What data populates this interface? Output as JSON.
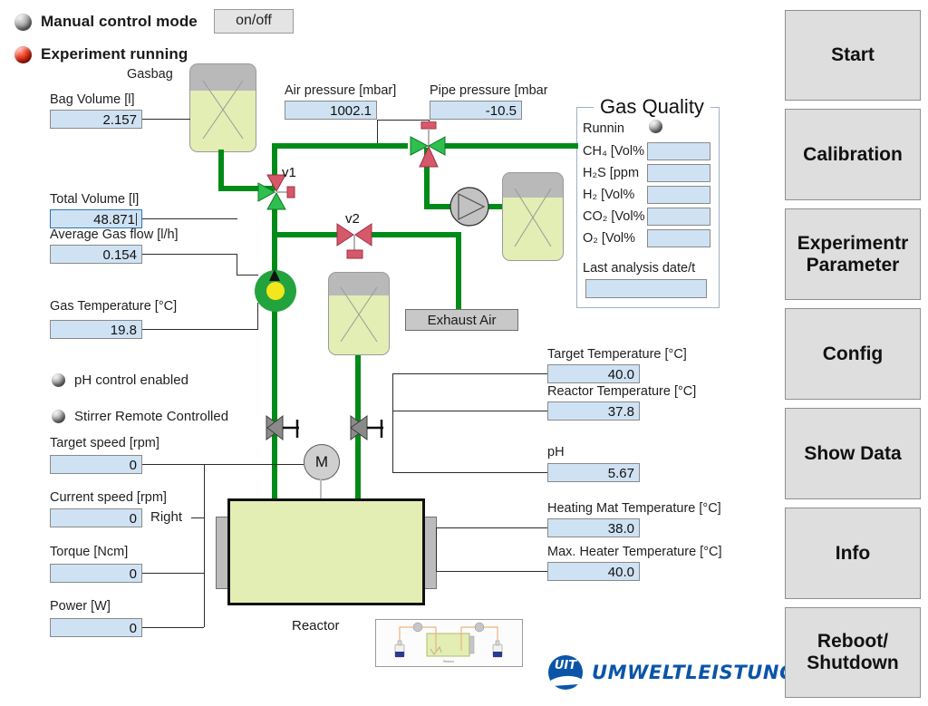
{
  "status": {
    "manual_mode": {
      "label": "Manual control mode",
      "led": "gray-led",
      "button": "on/off"
    },
    "experiment": {
      "label": "Experiment running",
      "led": "red-led"
    }
  },
  "gasbag": {
    "caption": "Gasbag",
    "bag_volume": {
      "label": "Bag Volume [l]",
      "value": "2.157"
    }
  },
  "pressures": {
    "air": {
      "label": "Air pressure [mbar]",
      "value": "1002.1"
    },
    "pipe": {
      "label": "Pipe pressure [mbar]",
      "value": "-10.5"
    }
  },
  "gas_measures": {
    "total_volume": {
      "label": "Total Volume [l]",
      "value": "48.871"
    },
    "avg_gas_flow": {
      "label": "Average Gas flow [l/h]",
      "value": "0.154"
    },
    "gas_temperature": {
      "label": "Gas Temperature [°C]",
      "value": "19.8"
    }
  },
  "gas_quality": {
    "title": "Gas Quality",
    "running": {
      "label": "Runnin",
      "led": "gray-led"
    },
    "rows": [
      {
        "label": "CH₄ [Vol%",
        "value": ""
      },
      {
        "label": "H₂S [ppm",
        "value": ""
      },
      {
        "label": "H₂ [Vol%",
        "value": ""
      },
      {
        "label": "CO₂ [Vol%",
        "value": ""
      },
      {
        "label": "O₂ [Vol%",
        "value": ""
      }
    ],
    "last_analysis": {
      "label": "Last analysis date/t",
      "value": ""
    }
  },
  "valves": {
    "v1": "v1",
    "v2": "v2"
  },
  "exhaust": {
    "label": "Exhaust Air"
  },
  "controls": {
    "ph_control": {
      "label": "pH control enabled",
      "led": "gray-led"
    },
    "stirrer_remote": {
      "label": "Stirrer Remote Controlled",
      "led": "gray-led"
    },
    "target_speed": {
      "label": "Target speed [rpm]",
      "value": "0"
    },
    "current_speed": {
      "label": "Current speed [rpm]",
      "value": "0"
    },
    "direction": "Right",
    "torque": {
      "label": "Torque [Ncm]",
      "value": "0"
    },
    "power": {
      "label": "Power [W]",
      "value": "0"
    }
  },
  "reactor": {
    "caption": "Reactor",
    "motor": "M",
    "target_temperature": {
      "label": "Target Temperature [°C]",
      "value": "40.0"
    },
    "reactor_temperature": {
      "label": "Reactor Temperature [°C]",
      "value": "37.8"
    },
    "ph": {
      "label": "pH",
      "value": "5.67"
    },
    "heating_mat_temperature": {
      "label": "Heating Mat Temperature [°C]",
      "value": "38.0"
    },
    "max_heater_temperature": {
      "label": "Max. Heater Temperature [°C]",
      "value": "40.0"
    }
  },
  "nav_buttons": [
    {
      "label": "Start",
      "name": "start"
    },
    {
      "label": "Calibration",
      "name": "calibration"
    },
    {
      "label": "Experimentr Parameter",
      "name": "experiment-parameter"
    },
    {
      "label": "Config",
      "name": "config"
    },
    {
      "label": "Show Data",
      "name": "show-data"
    },
    {
      "label": "Info",
      "name": "info"
    },
    {
      "label": "Reboot/ Shutdown",
      "name": "reboot-shutdown"
    }
  ],
  "logo": {
    "mark": "UIT",
    "word": "UMWELTLEISTUNGEN"
  },
  "colors": {
    "pipe_green": "#008a18",
    "valve_open": "#2fbf4f",
    "valve_closed": "#d6586a",
    "field_blue": "#cfe2f3",
    "liquid_green": "#e2eeb4",
    "brand_blue": "#0a55a8",
    "led_on_red": "#ef3b22"
  }
}
